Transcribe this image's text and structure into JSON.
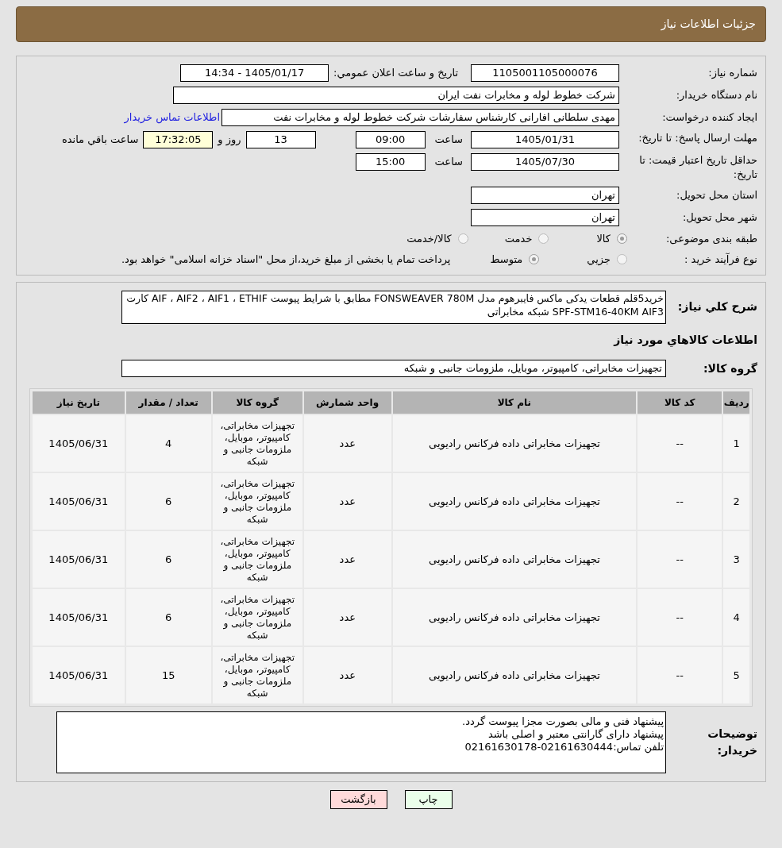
{
  "header": {
    "title": "جزئیات اطلاعات نیاز"
  },
  "details": {
    "need_number": {
      "label": "شماره نیاز:",
      "value": "1105001105000076"
    },
    "announce": {
      "label": "تاريخ و ساعت اعلان عمومي:",
      "value": "1405/01/17 - 14:34"
    },
    "buyer": {
      "label": "نام دستگاه خریدار:",
      "value": "شرکت خطوط لوله و مخابرات نفت ایران"
    },
    "creator": {
      "label": "ایجاد کننده درخواست:",
      "value": "مهدی سلطانی افارانی کارشناس سفارشات  شرکت خطوط لوله و مخابرات نفت",
      "link": "اطلاعات تماس خریدار"
    },
    "deadline": {
      "label": "مهلت ارسال پاسخ: تا تاریخ:",
      "date": "1405/01/31",
      "time_label": "ساعت",
      "time": "09:00",
      "days": "13",
      "days_label": "روز و",
      "remaining": "17:32:05",
      "remaining_label": "ساعت باقي مانده"
    },
    "validity": {
      "label": "حداقل تاریخ اعتبار قیمت: تا تاریخ:",
      "date": "1405/07/30",
      "time_label": "ساعت",
      "time": "15:00"
    },
    "province": {
      "label": "استان محل تحویل:",
      "value": "تهران"
    },
    "city": {
      "label": "شهر محل تحویل:",
      "value": "تهران"
    },
    "category": {
      "label": "طبقه بندی موضوعی:",
      "options": [
        {
          "label": "كالا",
          "selected": true
        },
        {
          "label": "خدمت",
          "selected": false
        },
        {
          "label": "كالا/خدمت",
          "selected": false
        }
      ]
    },
    "process": {
      "label": "نوع فرآیند خرید :",
      "options": [
        {
          "label": "جزيي",
          "selected": false
        },
        {
          "label": "متوسط",
          "selected": true
        }
      ],
      "note": "پرداخت تمام یا بخشی از مبلغ خرید،از محل \"اسناد خزانه اسلامی\" خواهد بود."
    }
  },
  "needs": {
    "summary": {
      "label": "شرح كلي نياز:",
      "value": "خرید5قلم  قطعات یدکی ماکس فایبرهوم مدل FONSWEAVER 780M  مطابق با شرایط پیوست AIF ، AIF2  ،  AIF1 ، ETHIF کارت SPF-STM16-40KM  AIF3  شبکه مخابراتی"
    },
    "section_title": "اطلاعات كالاهاي مورد نياز",
    "group": {
      "label": "گروه کالا:",
      "value": "تجهیزات مخابراتی، کامپیوتر، موبایل، ملزومات جانبی و شبکه"
    },
    "table": {
      "columns": [
        "ردیف",
        "کد کالا",
        "نام کالا",
        "واحد شمارش",
        "گروه کالا",
        "تعداد / مقدار",
        "تاریخ نیاز"
      ],
      "rows": [
        [
          "1",
          "--",
          "تجهیزات مخابراتی داده فرکانس رادیویی",
          "عدد",
          "تجهیزات مخابراتی، کامپیوتر، موبایل، ملزومات جانبی و شبکه",
          "4",
          "1405/06/31"
        ],
        [
          "2",
          "--",
          "تجهیزات مخابراتی داده فرکانس رادیویی",
          "عدد",
          "تجهیزات مخابراتی، کامپیوتر، موبایل، ملزومات جانبی و شبکه",
          "6",
          "1405/06/31"
        ],
        [
          "3",
          "--",
          "تجهیزات مخابراتی داده فرکانس رادیویی",
          "عدد",
          "تجهیزات مخابراتی، کامپیوتر، موبایل، ملزومات جانبی و شبکه",
          "6",
          "1405/06/31"
        ],
        [
          "4",
          "--",
          "تجهیزات مخابراتی داده فرکانس رادیویی",
          "عدد",
          "تجهیزات مخابراتی، کامپیوتر، موبایل، ملزومات جانبی و شبکه",
          "6",
          "1405/06/31"
        ],
        [
          "5",
          "--",
          "تجهیزات مخابراتی داده فرکانس رادیویی",
          "عدد",
          "تجهیزات مخابراتی، کامپیوتر، موبایل، ملزومات جانبی و شبکه",
          "15",
          "1405/06/31"
        ]
      ]
    },
    "notes": {
      "label": "توضیحات خریدار:",
      "lines": [
        "پیشنهاد فنی و مالی بصورت مجزا پیوست گردد.",
        "پیشنهاد  دارای گارانتی معتبر و اصلی  باشد",
        "تلفن تماس:02161630444-02161630178"
      ]
    }
  },
  "buttons": [
    {
      "label": "چاپ",
      "kind": "print"
    },
    {
      "label": "بازگشت",
      "kind": "back"
    }
  ]
}
